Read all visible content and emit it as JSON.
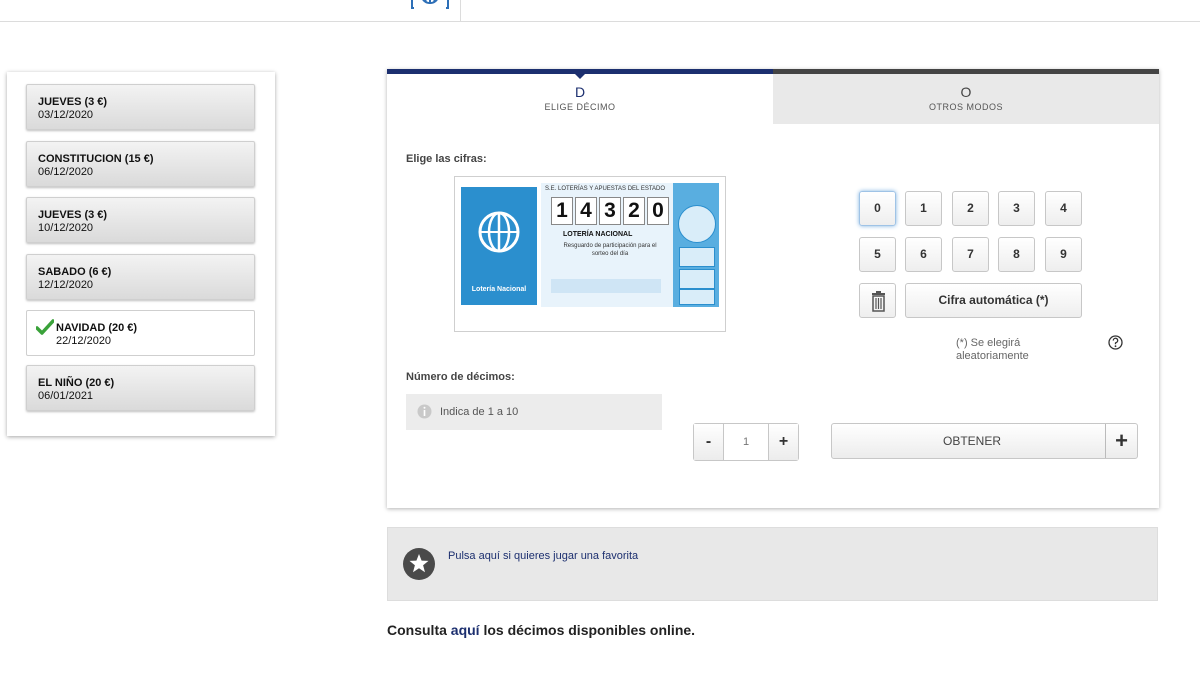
{
  "draws": [
    {
      "name": "JUEVES (3 €)",
      "date": "03/12/2020",
      "selected": false
    },
    {
      "name": "CONSTITUCION (15 €)",
      "date": "06/12/2020",
      "selected": false
    },
    {
      "name": "JUEVES (3 €)",
      "date": "10/12/2020",
      "selected": false
    },
    {
      "name": "SABADO (6 €)",
      "date": "12/12/2020",
      "selected": false
    },
    {
      "name": "NAVIDAD (20 €)",
      "date": "22/12/2020",
      "selected": true
    },
    {
      "name": "EL NIÑO (20 €)",
      "date": "06/01/2021",
      "selected": false
    }
  ],
  "tabs": [
    {
      "letter": "D",
      "label": "ELIGE DÉCIMO"
    },
    {
      "letter": "O",
      "label": "OTROS MODOS"
    }
  ],
  "digits_section": {
    "label": "Elige las cifras:"
  },
  "ticket": {
    "header": "S.E. LOTERÍAS Y APUESTAS DEL ESTADO",
    "digits": [
      "1",
      "4",
      "3",
      "2",
      "0"
    ],
    "title": "LOTERÍA NACIONAL",
    "subtitle": "Resguardo de participación para el sorteo del día",
    "brand": "Lotería Nacional"
  },
  "keypad": {
    "keys": [
      "0",
      "1",
      "2",
      "3",
      "4",
      "5",
      "6",
      "7",
      "8",
      "9"
    ],
    "auto_label": "Cifra automática (*)",
    "auto_note": "(*) Se elegirá aleatoriamente"
  },
  "decimos": {
    "label": "Número de décimos:",
    "hint": "Indica de 1 a 10",
    "minus": "-",
    "plus": "+",
    "placeholder": "1"
  },
  "obtener": {
    "label": "OBTENER",
    "plus": "+"
  },
  "favorite": {
    "text": "Pulsa aquí si quieres jugar una favorita"
  },
  "footer": {
    "before": "Consulta ",
    "link": "aquí",
    "after": " los décimos disponibles online."
  },
  "colors": {
    "primary": "#1c2f6f",
    "ticket_blue": "#2b8fce",
    "check_green": "#3aa23a"
  }
}
